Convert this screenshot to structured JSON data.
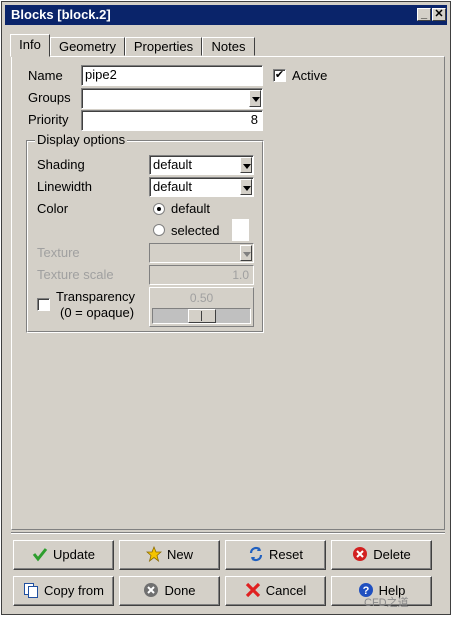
{
  "window": {
    "title": "Blocks [block.2]"
  },
  "title_buttons": {
    "minimize": "_",
    "close": "✕"
  },
  "tabs": [
    {
      "label": "Info"
    },
    {
      "label": "Geometry"
    },
    {
      "label": "Properties"
    },
    {
      "label": "Notes"
    }
  ],
  "info": {
    "name_label": "Name",
    "name_value": "pipe2",
    "active_label": "Active",
    "active_checked": true,
    "groups_label": "Groups",
    "groups_value": "",
    "priority_label": "Priority",
    "priority_value": "8"
  },
  "display": {
    "title": "Display options",
    "shading_label": "Shading",
    "shading_value": "default",
    "linewidth_label": "Linewidth",
    "linewidth_value": "default",
    "color_label": "Color",
    "color_default_label": "default",
    "color_selected_label": "selected",
    "color_choice": "default",
    "texture_label": "Texture",
    "texture_scale_label": "Texture scale",
    "texture_scale_value": "1.0",
    "transparency_label_1": "Transparency",
    "transparency_label_2": "(0 = opaque)",
    "transparency_value": "0.50",
    "transparency_checked": false
  },
  "buttons": {
    "update": "Update",
    "new": "New",
    "reset": "Reset",
    "delete": "Delete",
    "copy_from": "Copy from",
    "done": "Done",
    "cancel": "Cancel",
    "help": "Help"
  },
  "watermark": "CFD之道",
  "colors": {
    "title_bar": "#0a246a",
    "face": "#d4d0c8",
    "check_green": "#2e9e2e",
    "star_yellow": "#f5c400",
    "delete_red": "#d22020",
    "help_blue": "#2050c0"
  }
}
